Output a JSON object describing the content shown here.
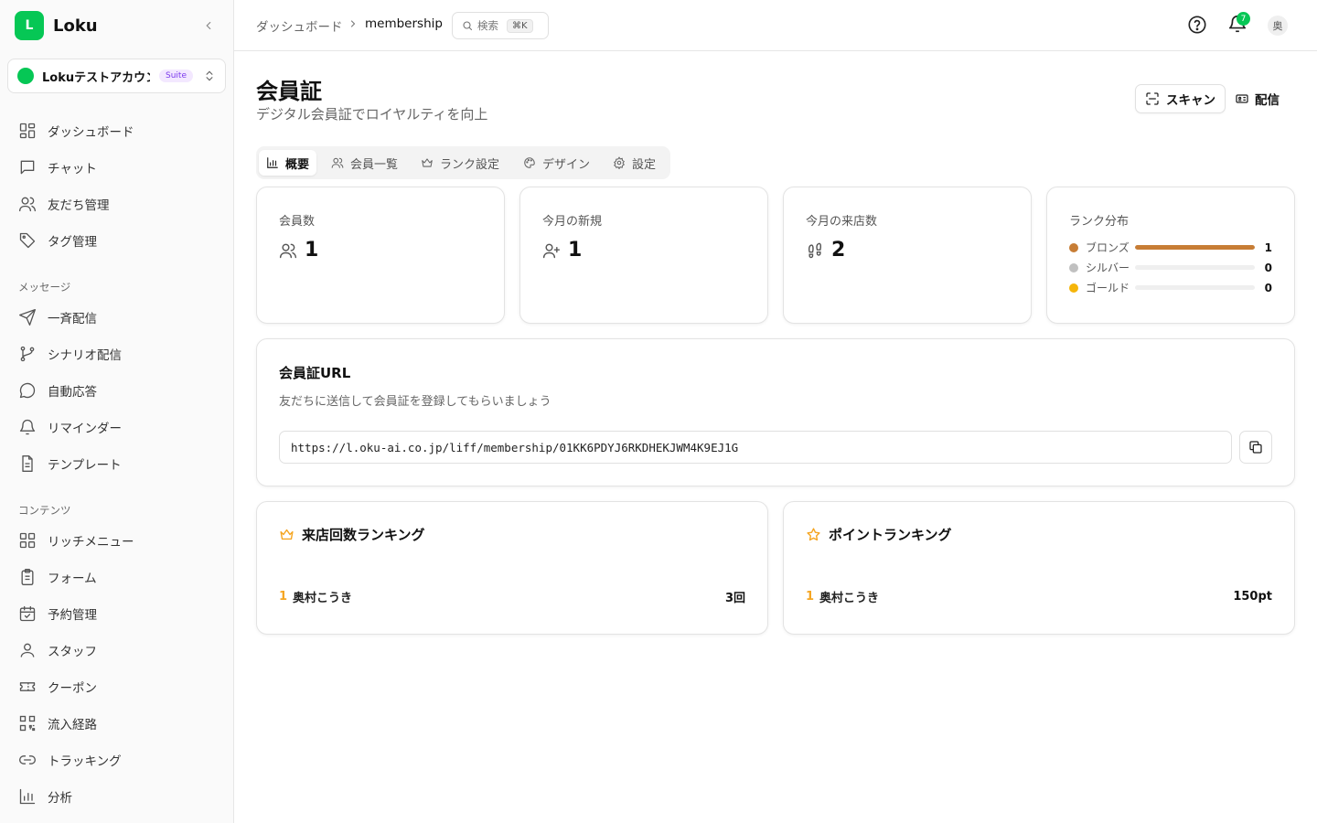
{
  "brand": {
    "logo_letter": "L",
    "name": "Loku"
  },
  "account": {
    "name": "Lokuテストアカウント",
    "badge": "Suite"
  },
  "nav": {
    "main": [
      {
        "label": "ダッシュボード",
        "icon": "layout-grid-icon"
      },
      {
        "label": "チャット",
        "icon": "message-square-icon"
      },
      {
        "label": "友だち管理",
        "icon": "users-icon"
      },
      {
        "label": "タグ管理",
        "icon": "tag-icon"
      }
    ],
    "message_section": "メッセージ",
    "message": [
      {
        "label": "一斉配信",
        "icon": "send-icon"
      },
      {
        "label": "シナリオ配信",
        "icon": "git-branch-icon"
      },
      {
        "label": "自動応答",
        "icon": "message-circle-icon"
      },
      {
        "label": "リマインダー",
        "icon": "bell-icon"
      },
      {
        "label": "テンプレート",
        "icon": "file-text-icon"
      }
    ],
    "content_section": "コンテンツ",
    "content": [
      {
        "label": "リッチメニュー",
        "icon": "layout-grid-icon"
      },
      {
        "label": "フォーム",
        "icon": "clipboard-list-icon"
      },
      {
        "label": "予約管理",
        "icon": "calendar-check-icon"
      },
      {
        "label": "スタッフ",
        "icon": "user-icon"
      },
      {
        "label": "クーポン",
        "icon": "ticket-icon"
      },
      {
        "label": "流入経路",
        "icon": "qr-code-icon"
      },
      {
        "label": "トラッキング",
        "icon": "link-icon"
      },
      {
        "label": "分析",
        "icon": "bar-chart-icon"
      }
    ]
  },
  "header": {
    "breadcrumb_root": "ダッシュボード",
    "breadcrumb_current": "membership",
    "search_label": "検索",
    "search_shortcut": "⌘K",
    "notification_count": "7",
    "avatar_text": "奥"
  },
  "page": {
    "title": "会員証",
    "subtitle": "デジタル会員証でロイヤルティを向上",
    "scan_label": "スキャン",
    "send_label": "配信"
  },
  "tabs": [
    {
      "label": "概要",
      "icon": "bar-chart-icon"
    },
    {
      "label": "会員一覧",
      "icon": "users-icon"
    },
    {
      "label": "ランク設定",
      "icon": "crown-icon"
    },
    {
      "label": "デザイン",
      "icon": "palette-icon"
    },
    {
      "label": "設定",
      "icon": "gear-icon"
    }
  ],
  "stats": {
    "members": {
      "label": "会員数",
      "value": "1"
    },
    "new_this_month": {
      "label": "今月の新規",
      "value": "1"
    },
    "visits_this_month": {
      "label": "今月の来店数",
      "value": "2"
    }
  },
  "rank_distribution": {
    "title": "ランク分布",
    "ranks": [
      {
        "name": "ブロンズ",
        "count": "1",
        "color": "#c77d35",
        "fraction": 1.0
      },
      {
        "name": "シルバー",
        "count": "0",
        "color": "#c0c0c0",
        "fraction": 0
      },
      {
        "name": "ゴールド",
        "count": "0",
        "color": "#f5b50a",
        "fraction": 0
      }
    ]
  },
  "member_url": {
    "title": "会員証URL",
    "description": "友だちに送信して会員証を登録してもらいましょう",
    "url": "https://l.oku-ai.co.jp/liff/membership/01KK6PDYJ6RKDHEKJWM4K9EJ1G"
  },
  "visit_ranking": {
    "title": "来店回数ランキング",
    "rows": [
      {
        "rank": "1",
        "name": "奥村こうき",
        "value": "3回"
      }
    ]
  },
  "point_ranking": {
    "title": "ポイントランキング",
    "rows": [
      {
        "rank": "1",
        "name": "奥村こうき",
        "value": "150pt"
      }
    ]
  },
  "colors": {
    "accent": "#06c755",
    "gold": "#f5a623"
  }
}
